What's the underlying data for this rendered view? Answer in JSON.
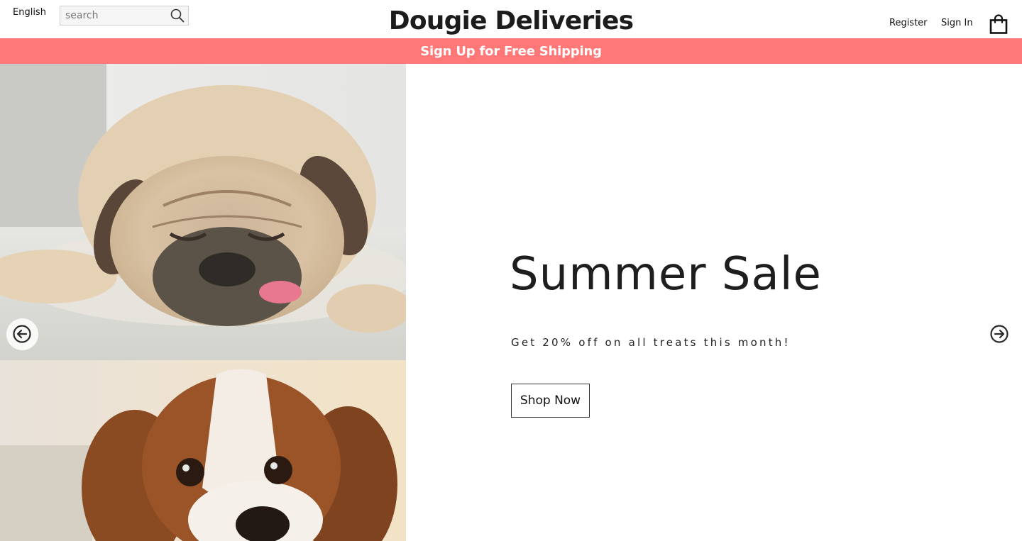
{
  "header": {
    "language": "English",
    "search": {
      "placeholder": "search",
      "value": ""
    },
    "brand": "Dougie Deliveries",
    "register_label": "Register",
    "signin_label": "Sign In",
    "cart_icon": "shopping-bag-icon"
  },
  "promo": {
    "text": "Sign Up for Free Shipping",
    "background": "#ff7777"
  },
  "hero": {
    "title": "Summer Sale",
    "subtitle": "Get 20% off on all treats this month!",
    "cta_label": "Shop Now"
  },
  "carousel": {
    "prev_icon": "arrow-left-circle-icon",
    "next_icon": "arrow-right-circle-icon"
  },
  "colors": {
    "accent": "#ff7777",
    "text": "#1e1e1e",
    "background": "#ffffff"
  }
}
